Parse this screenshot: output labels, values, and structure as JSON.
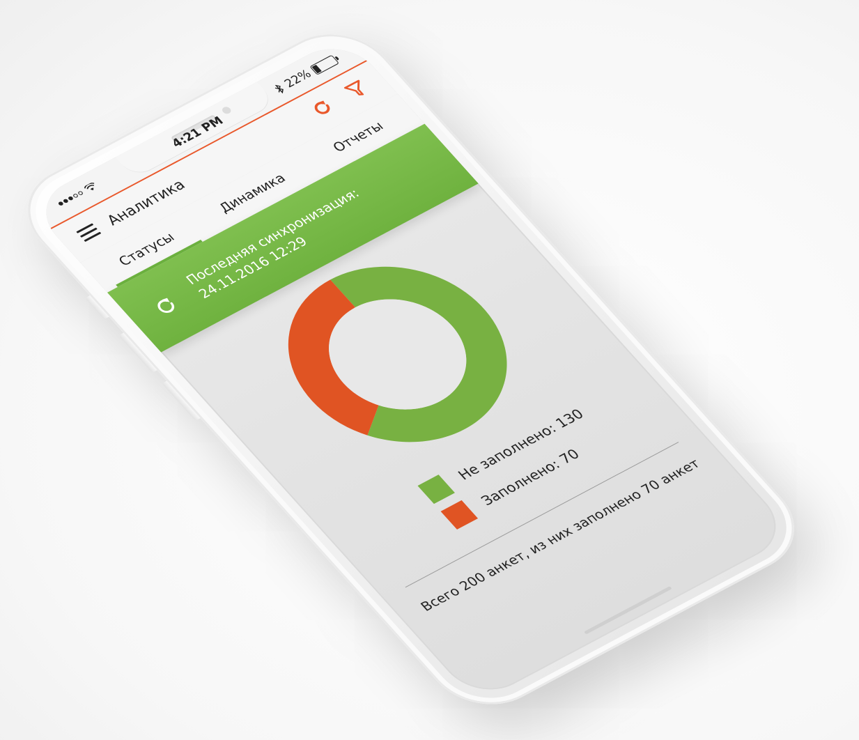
{
  "status_bar": {
    "time": "4:21 PM",
    "battery_text": "22%",
    "battery_level": 0.22
  },
  "header": {
    "title": "Аналитика"
  },
  "tabs": [
    {
      "label": "Статусы",
      "active": true
    },
    {
      "label": "Динамика",
      "active": false
    },
    {
      "label": "Отчеты",
      "active": false
    }
  ],
  "sync": {
    "label": "Последняя синхронизация:",
    "datetime": "24.11.2016 12:29"
  },
  "chart_data": {
    "type": "pie",
    "categories": [
      "Не заполнено",
      "Заполнено"
    ],
    "values": [
      130,
      70
    ],
    "colors": [
      "#78b142",
      "#e05423"
    ],
    "legend": [
      "Не заполнено: 130",
      "Заполнено: 70"
    ],
    "donut": true
  },
  "summary": {
    "text": "Всего 200 анкет, из них заполнено 70 анкет"
  },
  "colors": {
    "accent": "#e9582b",
    "green": "#78b142",
    "orange": "#e05423"
  },
  "icons": {
    "refresh": "refresh-icon",
    "filter": "filter-icon",
    "menu": "menu-icon",
    "sync": "sync-icon"
  }
}
